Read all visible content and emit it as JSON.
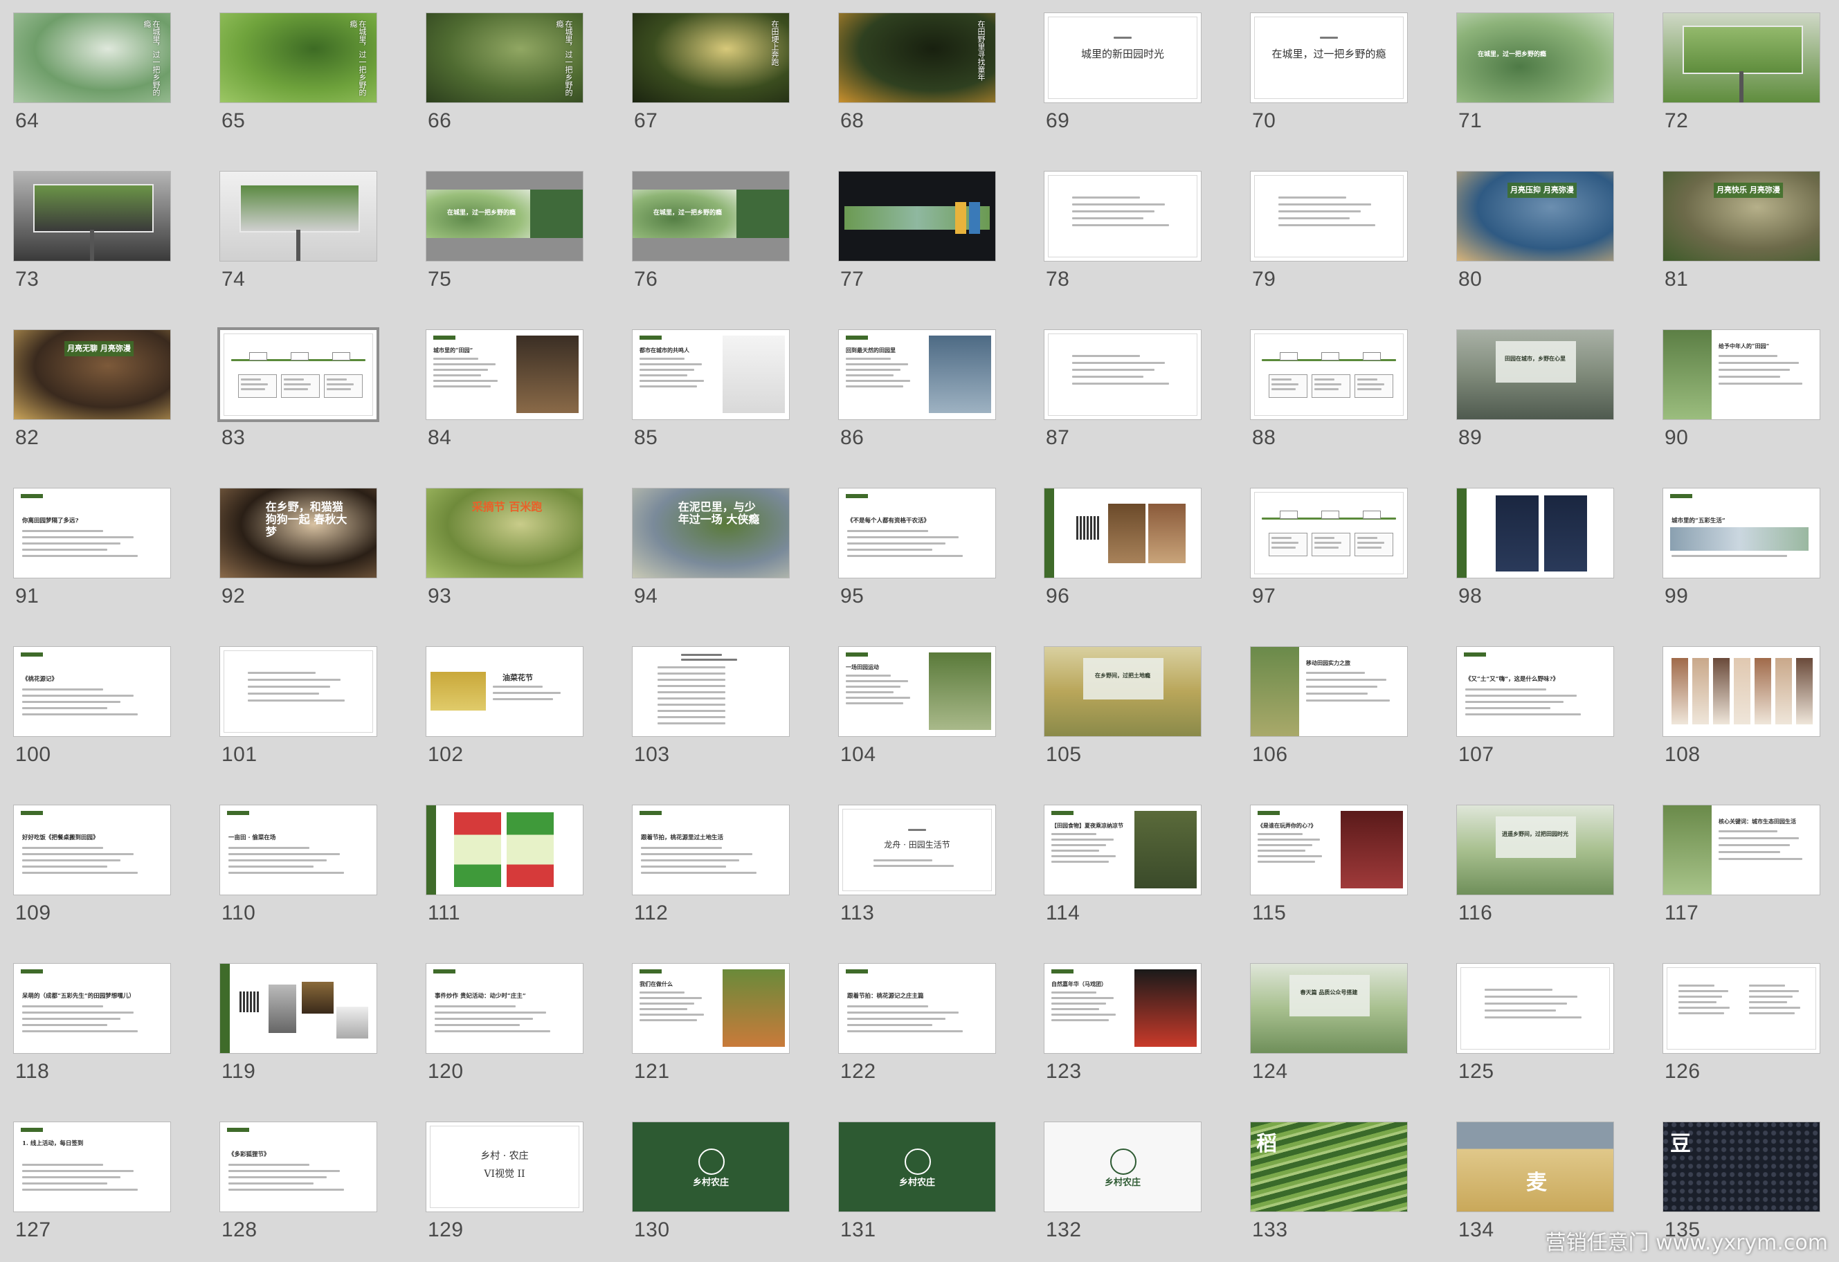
{
  "view": "slide-sorter",
  "slides": [
    {
      "num": "64",
      "style": "photo",
      "colors": [
        "#6f9e6a",
        "#a8c7a2",
        "#dfe8dc"
      ],
      "vtext": "在城里，过一把乡野的瘾"
    },
    {
      "num": "65",
      "style": "photo",
      "colors": [
        "#6fa33c",
        "#9cc765",
        "#3d6b24"
      ],
      "vtext": "在城里，过一把乡野的瘾"
    },
    {
      "num": "66",
      "style": "photo",
      "colors": [
        "#4f6b31",
        "#2c3f1d",
        "#91a763"
      ],
      "vtext": "在城里，过一把乡野的瘾"
    },
    {
      "num": "67",
      "style": "photo",
      "colors": [
        "#3b4d1f",
        "#1b2410",
        "#d8c97a"
      ],
      "vtext": "在田埂上奔跑"
    },
    {
      "num": "68",
      "style": "photo",
      "colors": [
        "#2f4020",
        "#c9902e",
        "#18200f"
      ],
      "vtext": "在田野里寻找童年"
    },
    {
      "num": "69",
      "style": "title",
      "title": "城里的新田园时光"
    },
    {
      "num": "70",
      "style": "title",
      "title": "在城里，过一把乡野的瘾"
    },
    {
      "num": "71",
      "style": "banner",
      "colors": [
        "#4e7a46",
        "#8db37a",
        "#c9dcc0"
      ],
      "headline": "在城里，过一把乡野的瘾"
    },
    {
      "num": "72",
      "style": "billboard",
      "colors": [
        "#5f8d3d",
        "#93b96c",
        "#cfd8c6"
      ]
    },
    {
      "num": "73",
      "style": "billboard",
      "colors": [
        "#3a3a3a",
        "#6b9447",
        "#b5b5b5"
      ]
    },
    {
      "num": "74",
      "style": "billboard",
      "colors": [
        "#d0d0d0",
        "#5b8a42",
        "#f0f0f0"
      ]
    },
    {
      "num": "75",
      "style": "banner2",
      "colors": [
        "#5f8a4b",
        "#9abf7b",
        "#dbe6d2"
      ],
      "headline": "在城里，过一把乡野的瘾"
    },
    {
      "num": "76",
      "style": "banner2",
      "colors": [
        "#557f45",
        "#8fb576",
        "#dbe6d2"
      ],
      "headline": "在城里，过一把乡野的瘾"
    },
    {
      "num": "77",
      "style": "dark",
      "colors": [
        "#14161a",
        "#6b9a52",
        "#e8b33c"
      ]
    },
    {
      "num": "78",
      "style": "text"
    },
    {
      "num": "79",
      "style": "text"
    },
    {
      "num": "80",
      "style": "photo2",
      "colors": [
        "#2f5a83",
        "#d7b47a",
        "#6c8fb0"
      ],
      "headline": "月亮压抑 月亮弥漫"
    },
    {
      "num": "81",
      "style": "photo2",
      "colors": [
        "#6d6a4a",
        "#3e5b2a",
        "#b6b08a"
      ],
      "headline": "月亮快乐 月亮弥漫"
    },
    {
      "num": "82",
      "style": "photo2",
      "colors": [
        "#3a2a1e",
        "#c9a45a",
        "#7d5a3a"
      ],
      "headline": "月亮无聊 月亮弥漫"
    },
    {
      "num": "83",
      "style": "diagram",
      "selected": true
    },
    {
      "num": "84",
      "style": "split",
      "title": "城市里的“田园”",
      "colors": [
        "#3a2e24",
        "#8a6a48"
      ]
    },
    {
      "num": "85",
      "style": "split",
      "title": "都市在城市的共鸣人",
      "colors": [
        "#f4f4f4",
        "#d9d9d9"
      ]
    },
    {
      "num": "86",
      "style": "split",
      "title": "回到最天然的田园里",
      "colors": [
        "#4d6a84",
        "#9eb2c2"
      ]
    },
    {
      "num": "87",
      "style": "text"
    },
    {
      "num": "88",
      "style": "diagram"
    },
    {
      "num": "89",
      "style": "photo3",
      "colors": [
        "#4f5a4f",
        "#7f8a7a",
        "#a9b1a6"
      ],
      "headline": "田园在城市，乡野在心里"
    },
    {
      "num": "90",
      "style": "split2",
      "colors": [
        "#5c7f45",
        "#9bbd7e"
      ],
      "title": "给予中年人的“田园”"
    },
    {
      "num": "91",
      "style": "titletag",
      "title": "你离田园梦隔了多远?"
    },
    {
      "num": "92",
      "style": "photo4",
      "colors": [
        "#2a1f16",
        "#8a6a4a",
        "#d9c3a3"
      ],
      "headline": "在乡野，和猫猫狗狗一起 春秋大梦",
      "hcolor": "#ffffff"
    },
    {
      "num": "93",
      "style": "photo4",
      "colors": [
        "#6f8a3b",
        "#a9c26a",
        "#c9cc8a"
      ],
      "headline": "采摘节 百米跑",
      "hcolor": "#e8612a"
    },
    {
      "num": "94",
      "style": "photo4",
      "colors": [
        "#7a8a9a",
        "#c8c9b5",
        "#5a7a3a"
      ],
      "headline": "在泥巴里，与少年过一场 大侠瘾",
      "hcolor": "#ffffff"
    },
    {
      "num": "95",
      "style": "titletag",
      "title": "《不是每个人都有资格干农活》"
    },
    {
      "num": "96",
      "style": "qr",
      "colors": [
        "#6b4a2a",
        "#a8825a"
      ]
    },
    {
      "num": "97",
      "style": "diagram"
    },
    {
      "num": "98",
      "style": "posters",
      "colors": [
        "#1a2640",
        "#c92a2a"
      ]
    },
    {
      "num": "99",
      "style": "titletag2",
      "title": "城市里的“五彩生活”"
    },
    {
      "num": "100",
      "style": "titletag",
      "title": "《桃花源记》"
    },
    {
      "num": "101",
      "style": "text"
    },
    {
      "num": "102",
      "style": "split3",
      "title": "油菜花节",
      "colors": [
        "#c9a83a",
        "#e0cb6a"
      ]
    },
    {
      "num": "103",
      "style": "table"
    },
    {
      "num": "104",
      "style": "split",
      "title": "一场田园运动",
      "colors": [
        "#5a7a3a",
        "#a9b98a"
      ]
    },
    {
      "num": "105",
      "style": "photo3",
      "colors": [
        "#8a8a4a",
        "#b9a65a",
        "#d9d0a0"
      ],
      "headline": "在乡野间，过把土地瘾"
    },
    {
      "num": "106",
      "style": "split2",
      "colors": [
        "#6a8a4a",
        "#a9a96a"
      ],
      "title": "移动田园实力之旅"
    },
    {
      "num": "107",
      "style": "titletag",
      "title": "《又“土”又“嗨”，这是什么野味?》"
    },
    {
      "num": "108",
      "style": "strips",
      "colors": [
        "#a06a4a",
        "#c9a88a",
        "#6a4a3a",
        "#e0c8b0"
      ]
    },
    {
      "num": "109",
      "style": "titletag",
      "title": "好好吃饭《把餐桌搬到田园》"
    },
    {
      "num": "110",
      "style": "titletag",
      "title": "一亩田 · 偷菜在场"
    },
    {
      "num": "111",
      "style": "poster",
      "colors": [
        "#e7f2c8",
        "#d63a3a",
        "#3f9a3a"
      ]
    },
    {
      "num": "112",
      "style": "titletag",
      "title": "跟着节拍，桃花源里过土地生活"
    },
    {
      "num": "113",
      "style": "title2",
      "title": "龙舟 · 田园生活节"
    },
    {
      "num": "114",
      "style": "split",
      "title": "【田园食物】夏夜乘凉纳凉节",
      "colors": [
        "#5a6a3a",
        "#3a4a2a"
      ]
    },
    {
      "num": "115",
      "style": "split",
      "title": "《是谁在玩弄你的心?》",
      "colors": [
        "#5a1a1a",
        "#a03a3a"
      ]
    },
    {
      "num": "116",
      "style": "photo3",
      "colors": [
        "#6f8f5a",
        "#a8c08f",
        "#dfe6d9"
      ],
      "headline": "逍遥乡野间，过把田园时光"
    },
    {
      "num": "117",
      "style": "split2",
      "colors": [
        "#6a8a4a",
        "#a8c48a"
      ],
      "title": "核心关键词：城市生态田园生活"
    },
    {
      "num": "118",
      "style": "titletag",
      "title": "呆萌的（成都“五彩先生”的田园梦想嘿儿）"
    },
    {
      "num": "119",
      "style": "qr2"
    },
    {
      "num": "120",
      "style": "titletag",
      "title": "事件炒作 贵妃活动：动少时“庄主”"
    },
    {
      "num": "121",
      "style": "split",
      "title": "我们在做什么",
      "colors": [
        "#6a8a3a",
        "#c97a3a"
      ]
    },
    {
      "num": "122",
      "style": "titletag",
      "title": "跟着节拍：桃花源记之庄主篇"
    },
    {
      "num": "123",
      "style": "split",
      "title": "自然嘉年华（马戏团）",
      "colors": [
        "#1a1a1a",
        "#c93a2a"
      ]
    },
    {
      "num": "124",
      "style": "photo3",
      "colors": [
        "#6f8f5a",
        "#a8c08f",
        "#dfe6d9"
      ],
      "headline": "春天篇 品质公众号搭建"
    },
    {
      "num": "125",
      "style": "text"
    },
    {
      "num": "126",
      "style": "text2"
    },
    {
      "num": "127",
      "style": "titletag3",
      "title": "1. 线上活动，每日签到"
    },
    {
      "num": "128",
      "style": "titletag",
      "title": "《多彩狐狸节》"
    },
    {
      "num": "129",
      "style": "title3",
      "title": "乡村 · 农庄",
      "subtitle": "VI视觉 II"
    },
    {
      "num": "130",
      "style": "logo",
      "colors": [
        "#2d5a32",
        "#ffffff"
      ],
      "logo": "乡村农庄"
    },
    {
      "num": "131",
      "style": "logo",
      "colors": [
        "#2d5a32",
        "#ffffff"
      ],
      "logo": "乡村农庄"
    },
    {
      "num": "132",
      "style": "logo",
      "colors": [
        "#f7f7f7",
        "#2d5a32"
      ],
      "logo": "乡村农庄"
    },
    {
      "num": "133",
      "style": "terrace",
      "colors": [
        "#3a6a2a",
        "#7aa84a",
        "#a8c87a"
      ],
      "headline": "稻"
    },
    {
      "num": "134",
      "style": "field",
      "colors": [
        "#c9a85a",
        "#e0c88a",
        "#8a9aa8"
      ],
      "headline": "麦"
    },
    {
      "num": "135",
      "style": "beans",
      "colors": [
        "#1a1f2a",
        "#3a4050"
      ],
      "headline": "豆"
    }
  ],
  "watermark": "营销任意门 www.yxrym.com"
}
